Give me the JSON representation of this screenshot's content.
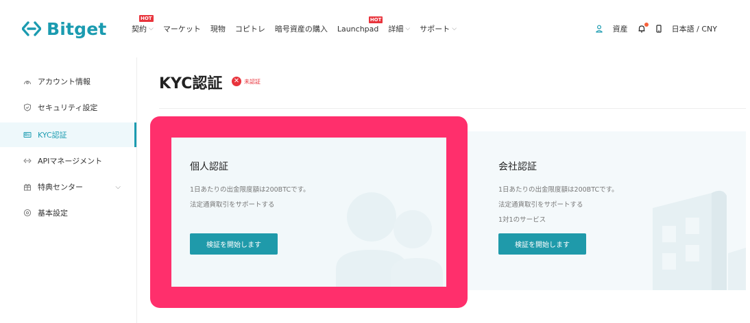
{
  "brand": {
    "name": "Bitget",
    "color": "#1b9bb0"
  },
  "nav": {
    "items": [
      {
        "label": "契約",
        "hot": true,
        "dropdown": true
      },
      {
        "label": "マーケット",
        "hot": false,
        "dropdown": false
      },
      {
        "label": "現物",
        "hot": false,
        "dropdown": false
      },
      {
        "label": "コピトレ",
        "hot": false,
        "dropdown": false
      },
      {
        "label": "暗号資産の購入",
        "hot": false,
        "dropdown": false
      },
      {
        "label": "Launchpad",
        "hot": true,
        "dropdown": false
      },
      {
        "label": "詳細",
        "hot": false,
        "dropdown": true
      },
      {
        "label": "サポート",
        "hot": false,
        "dropdown": true
      }
    ],
    "hot_label": "HOT",
    "assets_label": "資産",
    "language_label": "日本語 / CNY",
    "icons": [
      "user-icon",
      "bell-icon",
      "mobile-icon"
    ]
  },
  "sidebar": {
    "items": [
      {
        "label": "アカウント情報",
        "icon": "account-icon"
      },
      {
        "label": "セキュリティ設定",
        "icon": "shield-icon"
      },
      {
        "label": "KYC認証",
        "icon": "id-card-icon",
        "active": true
      },
      {
        "label": "APIマネージメント",
        "icon": "api-icon"
      },
      {
        "label": "特典センター",
        "icon": "gift-icon",
        "dropdown": true
      },
      {
        "label": "基本設定",
        "icon": "settings-icon"
      }
    ]
  },
  "main": {
    "title": "KYC認証",
    "status": "未認証",
    "status_color": "#e8343c"
  },
  "cards": {
    "personal": {
      "title": "個人認証",
      "desc_1": "1日あたりの出金限度額は200BTCです。",
      "desc_2": "法定通貨取引をサポートする",
      "button": "検証を開始します"
    },
    "company": {
      "title": "会社認証",
      "desc_1": "1日あたりの出金限度額は200BTCです。",
      "desc_2": "法定通貨取引をサポートする",
      "desc_3": "1対1のサービス",
      "button": "検証を開始します"
    }
  },
  "colors": {
    "accent": "#1f9aaa",
    "highlight": "#ff2f6c"
  }
}
